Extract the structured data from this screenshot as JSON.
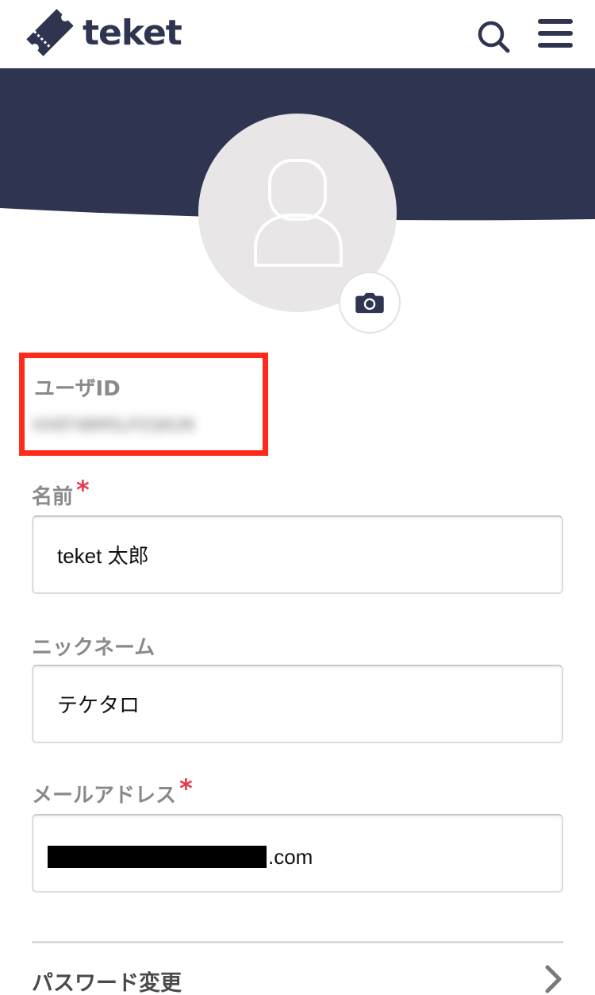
{
  "header": {
    "brand": "teket",
    "logo_icon": "ticket-icon",
    "search_icon": "search-icon",
    "menu_icon": "hamburger-menu-icon"
  },
  "colors": {
    "navy": "#2f3550",
    "avatar_bg": "#e8e6e7",
    "highlight_red": "#ff2a1a",
    "required_red": "#e8394b",
    "label_gray": "#8a8a8a"
  },
  "profile": {
    "avatar_icon": "user-silhouette-icon",
    "camera_icon": "camera-icon"
  },
  "user_id": {
    "label": "ユーザID",
    "value": "HX8T4BM5LP2QKUN"
  },
  "form": {
    "name": {
      "label": "名前",
      "required_mark": "*",
      "value": "teket 太郎"
    },
    "nickname": {
      "label": "ニックネーム",
      "value": "テケタロ"
    },
    "email": {
      "label": "メールアドレス",
      "required_mark": "*",
      "value_suffix": ".com"
    }
  },
  "password_change": {
    "label": "パスワード変更",
    "chevron_icon": "chevron-right-icon"
  }
}
